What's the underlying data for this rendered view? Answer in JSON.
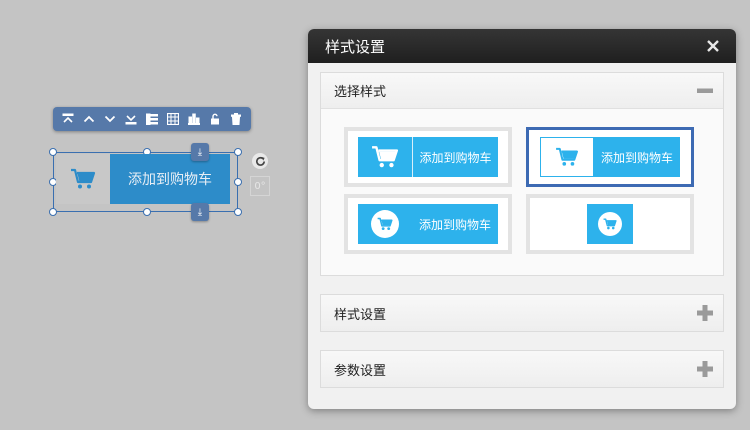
{
  "colors": {
    "accent": "#2db2ec",
    "widget_blue": "#2d8cc9",
    "toolbar": "#5679a9",
    "selected_border": "#3d6ab3",
    "header_dark": "#262626"
  },
  "toolbar": {
    "icons": [
      "move-top-icon",
      "move-up-icon",
      "move-down-icon",
      "move-bottom-icon",
      "list-icon",
      "table-icon",
      "bar-chart-icon",
      "unlock-icon",
      "trash-icon"
    ]
  },
  "widget": {
    "label": "添加到购物车",
    "angle": "0°"
  },
  "dialog": {
    "title": "样式设置",
    "sections": [
      {
        "title": "选择样式",
        "expanded": true
      },
      {
        "title": "样式设置",
        "expanded": false
      },
      {
        "title": "参数设置",
        "expanded": false
      }
    ],
    "styles": [
      {
        "label": "添加到购物车",
        "selected": false
      },
      {
        "label": "添加到购物车",
        "selected": true
      },
      {
        "label": "添加到购物车",
        "selected": false
      },
      {
        "label": "",
        "selected": false
      }
    ]
  }
}
